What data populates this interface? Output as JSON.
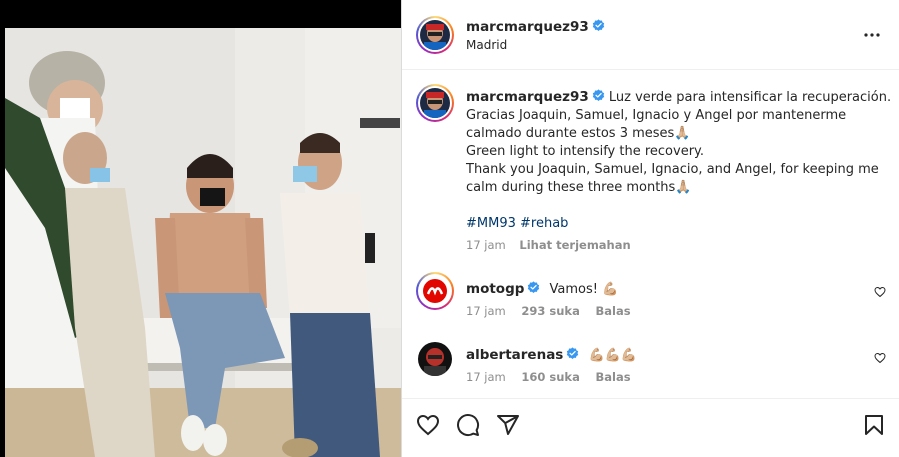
{
  "post": {
    "author": "marcmarquez93",
    "location": "Madrid"
  },
  "caption": {
    "username": "marcmarquez93",
    "lines": [
      "Luz verde para intensificar la recuperación.",
      "Gracias Joaquin, Samuel, Ignacio y Angel por mantenerme",
      "calmado durante estos 3 meses🙏🏼",
      "Green light to intensify the recovery.",
      "Thank you Joaquin, Samuel, Ignacio, and Angel, for keeping me",
      "calm during these three months🙏🏼"
    ],
    "hashtags": "#MM93 #rehab",
    "time": "17 jam",
    "translate": "Lihat terjemahan"
  },
  "comments": [
    {
      "username": "motogp",
      "text": "Vamos! 💪🏼",
      "time": "17 jam",
      "likes": "293 suka",
      "reply": "Balas"
    },
    {
      "username": "albertarenas",
      "text": "💪🏼💪🏼💪🏼",
      "time": "17 jam",
      "likes": "160 suka",
      "reply": "Balas"
    }
  ],
  "icons": {
    "more": "more-options-icon",
    "like": "heart-icon",
    "comment": "comment-icon",
    "share": "share-icon",
    "save": "bookmark-icon",
    "verified": "verified-badge-icon"
  },
  "colors": {
    "verified": "#3897f0",
    "hashtag": "#00376b",
    "meta": "#8e8e8e",
    "text": "#262626"
  }
}
